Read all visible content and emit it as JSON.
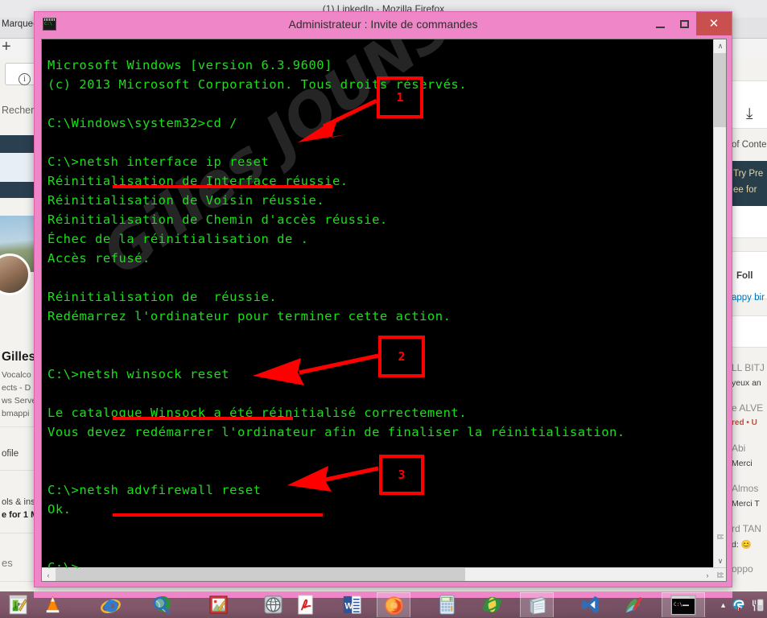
{
  "background_window": {
    "title": "(1) LinkedIn - Mozilla Firefox",
    "bookmark_label": "Marque-p",
    "newtab_label": "+",
    "info_icon": "i",
    "search_placeholder": "Recherc",
    "left_panel": {
      "profile_name": "Gilles",
      "lines": [
        "Vocalco",
        "ects - D",
        "ws Serve",
        "bmappi"
      ],
      "profile_link": "ofile",
      "promo_line_1": "ols & ins",
      "promo_line_2": "e for 1 M",
      "bottom_item": "es"
    },
    "right_panel": {
      "download_icon": "download-icon",
      "table_of_contents": "of Conte",
      "promo_line_1": "Try Pre",
      "promo_line_2": "ee for ",
      "follow_label": "Foll",
      "items": [
        "LL BITJ",
        "yeux an",
        "e ALVE",
        "red •  U",
        " Abi",
        " Merci",
        " Almos",
        " Merci T",
        "rd TAN",
        "d: 😊",
        "oppo",
        "appy bir"
      ]
    }
  },
  "cmd_window": {
    "icon": "console-icon",
    "title": "Administrateur : Invite de commandes",
    "minimize_label": "–",
    "maximize_label": "□",
    "close_label": "✕",
    "watermark": "Gilles JOUNSI - LeBlog",
    "console_text": "Microsoft Windows [version 6.3.9600]\n(c) 2013 Microsoft Corporation. Tous droits réservés.\n\nC:\\Windows\\system32>cd /\n\nC:\\>netsh interface ip reset\nRéinitialisation de Interface réussie.\nRéinitialisation de Voisin réussie.\nRéinitialisation de Chemin d'accès réussie.\nÉchec de la réinitialisation de .\nAccès refusé.\n\nRéinitialisation de  réussie.\nRedémarrez l'ordinateur pour terminer cette action.\n\n\nC:\\>netsh winsock reset\n\nLe catalogue Winsock a été réinitialisé correctement.\nVous devez redémarrer l'ordinateur afin de finaliser la réinitialisation.\n\n\nC:\\>netsh advfirewall reset\nOk.\n\n\nC:\\>",
    "annotations": [
      {
        "number": "1",
        "target": "netsh interface ip reset"
      },
      {
        "number": "2",
        "target": "netsh winsock reset"
      },
      {
        "number": "3",
        "target": "netsh advfirewall reset"
      }
    ],
    "scrollbar": {
      "up_arrow": "∧",
      "down_arrow": "∨",
      "left_arrow": "‹",
      "right_arrow": "›"
    },
    "colors": {
      "title_bar": "#ef86c8",
      "close_button": "#c9504f",
      "console_bg": "#000000",
      "console_fg": "#19e019",
      "annotation": "#ff0000"
    }
  },
  "taskbar": {
    "items": [
      {
        "name": "notepadpp",
        "label": "Notepad++",
        "active": false
      },
      {
        "name": "vlc",
        "label": "VLC media player",
        "active": false
      },
      {
        "name": "internet-explorer",
        "label": "Internet Explorer",
        "active": false
      },
      {
        "name": "search-globe",
        "label": "Rechercher",
        "active": false
      },
      {
        "name": "paint-image",
        "label": "Éditeur d'images",
        "active": false
      },
      {
        "name": "browser-globe",
        "label": "Navigateur",
        "active": false
      },
      {
        "name": "adobe-reader",
        "label": "Adobe Reader",
        "active": false
      },
      {
        "name": "word",
        "label": "Microsoft Word",
        "active": false
      },
      {
        "name": "firefox",
        "label": "Mozilla Firefox",
        "active": true
      },
      {
        "name": "calculator",
        "label": "Calculatrice",
        "active": false
      },
      {
        "name": "opera",
        "label": "Opera",
        "active": false
      },
      {
        "name": "notepad",
        "label": "Bloc-notes",
        "active": true
      },
      {
        "name": "visual-studio",
        "label": "Visual Studio",
        "active": false
      },
      {
        "name": "paint",
        "label": "Paint",
        "active": false
      },
      {
        "name": "command-prompt",
        "label": "Invite de commandes",
        "active": true
      }
    ],
    "tray": {
      "show_hidden": "▲",
      "edge_icon": "e",
      "volume_icon": "volume-icon",
      "warning_badge": "!"
    }
  }
}
